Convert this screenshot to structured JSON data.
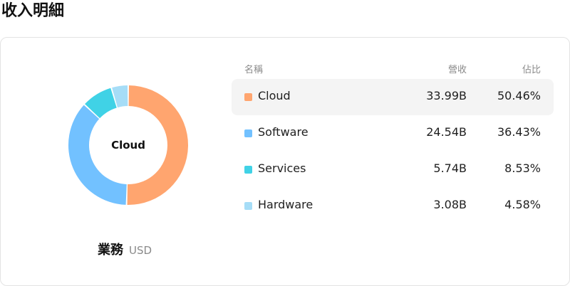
{
  "page": {
    "title": "收入明細"
  },
  "legend": {
    "category": "業務",
    "unit": "USD"
  },
  "donut": {
    "center_label": "Cloud"
  },
  "table": {
    "columns": [
      "名稱",
      "營收",
      "佔比"
    ],
    "rows": [
      {
        "name": "Cloud",
        "revenue": "33.99B",
        "share": "50.46%",
        "color": "#ffa56f",
        "active": true
      },
      {
        "name": "Software",
        "revenue": "24.54B",
        "share": "36.43%",
        "color": "#72c1ff",
        "active": false
      },
      {
        "name": "Services",
        "revenue": "5.74B",
        "share": "8.53%",
        "color": "#40d2e6",
        "active": false
      },
      {
        "name": "Hardware",
        "revenue": "3.08B",
        "share": "4.58%",
        "color": "#a6ddf7",
        "active": false
      }
    ]
  },
  "chart_data": {
    "type": "pie",
    "categories": [
      "Cloud",
      "Software",
      "Services",
      "Hardware"
    ],
    "values": [
      50.46,
      36.43,
      8.53,
      4.58
    ],
    "colors": [
      "#ffa56f",
      "#72c1ff",
      "#40d2e6",
      "#a6ddf7"
    ]
  }
}
